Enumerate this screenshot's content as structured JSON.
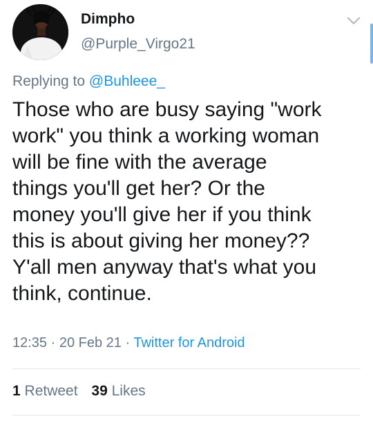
{
  "author": {
    "display_name": "Dimpho",
    "handle": "@Purple_Virgo21"
  },
  "reply": {
    "prefix": "Replying to",
    "handle": "@Buhleee_"
  },
  "tweet": {
    "text": "Those who are busy saying \"work\nwork\" you think a working woman\nwill be fine with the average\nthings you'll get her? Or the\nmoney you'll give her if you think\nthis is about giving her money??\nY'all men anyway that's what you\nthink, continue."
  },
  "meta": {
    "time": "12:35",
    "separator1": "·",
    "date": "20 Feb 21",
    "separator2": "·",
    "source": "Twitter for Android"
  },
  "stats": {
    "retweets_count": "1",
    "retweets_label": "Retweet",
    "likes_count": "39",
    "likes_label": "Likes"
  },
  "icons": {
    "caret": "chevron-down-icon"
  },
  "colors": {
    "link": "#1b95e0",
    "secondary_text": "#657786",
    "primary_text": "#14171a",
    "divider": "#e1e8ed"
  }
}
